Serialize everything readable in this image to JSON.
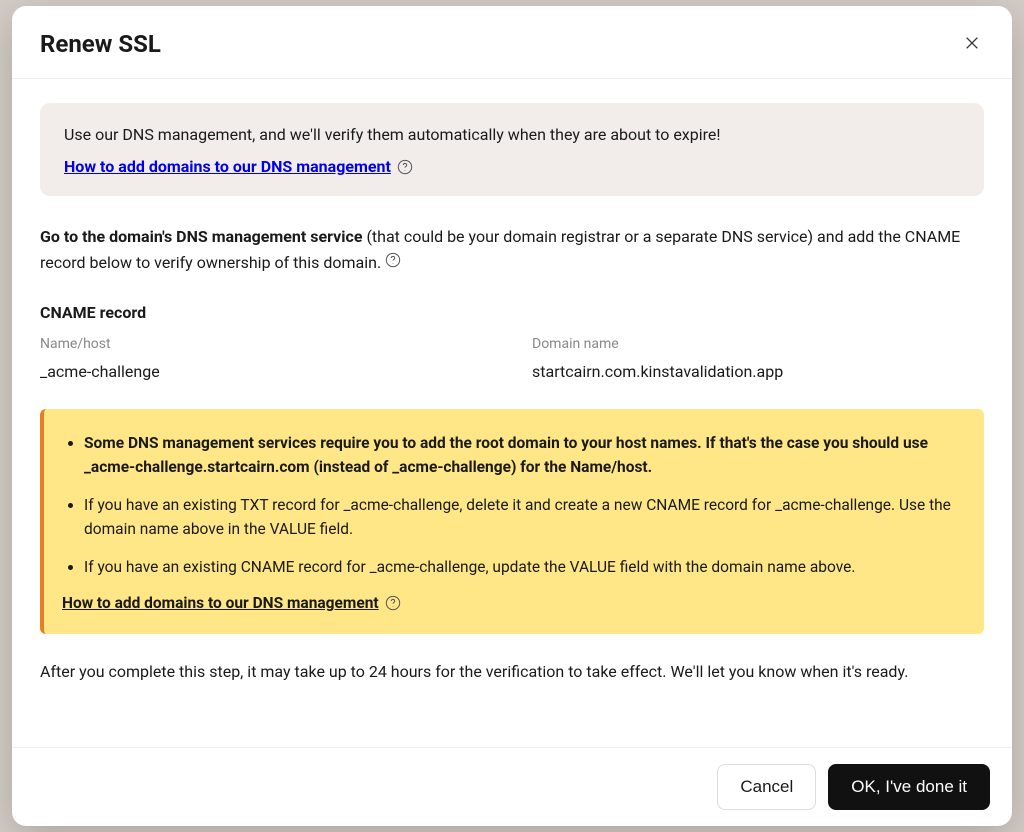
{
  "modal": {
    "title": "Renew SSL"
  },
  "banner": {
    "text": "Use our DNS management, and we'll verify them automatically when they are about to expire!",
    "link_text": "How to add domains to our DNS management"
  },
  "instruction": {
    "bold_prefix": "Go to the domain's DNS management service",
    "rest": " (that could be your domain registrar or a separate DNS service) and add the CNAME record below to verify ownership of this domain."
  },
  "cname": {
    "label": "CNAME record",
    "name_host_label": "Name/host",
    "name_host_value": "_acme-challenge",
    "domain_label": "Domain name",
    "domain_value": "startcairn.com.kinstavalidation.app"
  },
  "warning": {
    "items": [
      "Some DNS management services require you to add the root domain to your host names. If that's the case you should use _acme-challenge.startcairn.com (instead of _acme-challenge) for the Name/host.",
      "If you have an existing TXT record for _acme-challenge, delete it and create a new CNAME record for _acme-challenge. Use the domain name above in the VALUE field.",
      "If you have an existing CNAME record for _acme-challenge, update the VALUE field with the domain name above."
    ],
    "footer_link": "How to add domains to our DNS management"
  },
  "bottom_note": "After you complete this step, it may take up to 24 hours for the verification to take effect. We'll let you know when it's ready.",
  "footer": {
    "cancel": "Cancel",
    "confirm": "OK, I've done it"
  }
}
